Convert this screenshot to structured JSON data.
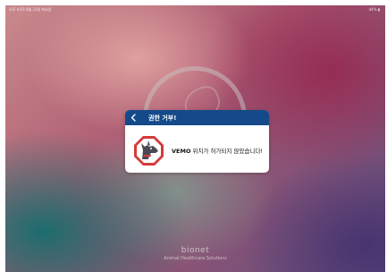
{
  "status_bar": {
    "left_text": "오후 4:03  4월 23일 화요일",
    "right_text": "44% ▮"
  },
  "background": {
    "brand_name": "bionet",
    "brand_subtitle": "Animal Healthcare Solutions"
  },
  "dialog": {
    "title": "권한 거부!",
    "message_strong": "VEMO",
    "message_rest": " 위치가 허가되지 않았습니다!",
    "icon": "guard-dog-stop-icon",
    "header_color": "#154a8a",
    "icon_color": "#d43a3a"
  }
}
